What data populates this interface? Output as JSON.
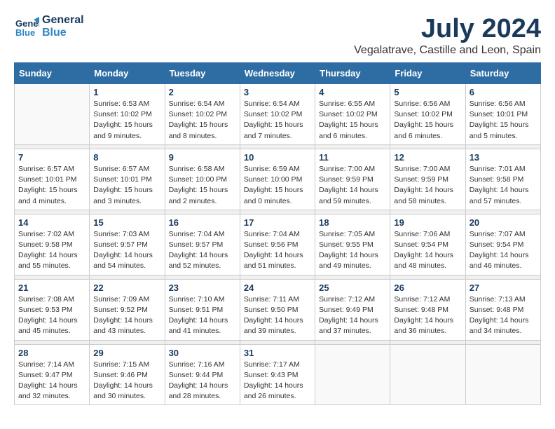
{
  "header": {
    "logo_line1": "General",
    "logo_line2": "Blue",
    "month_title": "July 2024",
    "location": "Vegalatrave, Castille and Leon, Spain"
  },
  "weekdays": [
    "Sunday",
    "Monday",
    "Tuesday",
    "Wednesday",
    "Thursday",
    "Friday",
    "Saturday"
  ],
  "weeks": [
    [
      {
        "day": "",
        "info": ""
      },
      {
        "day": "1",
        "info": "Sunrise: 6:53 AM\nSunset: 10:02 PM\nDaylight: 15 hours\nand 9 minutes."
      },
      {
        "day": "2",
        "info": "Sunrise: 6:54 AM\nSunset: 10:02 PM\nDaylight: 15 hours\nand 8 minutes."
      },
      {
        "day": "3",
        "info": "Sunrise: 6:54 AM\nSunset: 10:02 PM\nDaylight: 15 hours\nand 7 minutes."
      },
      {
        "day": "4",
        "info": "Sunrise: 6:55 AM\nSunset: 10:02 PM\nDaylight: 15 hours\nand 6 minutes."
      },
      {
        "day": "5",
        "info": "Sunrise: 6:56 AM\nSunset: 10:02 PM\nDaylight: 15 hours\nand 6 minutes."
      },
      {
        "day": "6",
        "info": "Sunrise: 6:56 AM\nSunset: 10:01 PM\nDaylight: 15 hours\nand 5 minutes."
      }
    ],
    [
      {
        "day": "7",
        "info": "Sunrise: 6:57 AM\nSunset: 10:01 PM\nDaylight: 15 hours\nand 4 minutes."
      },
      {
        "day": "8",
        "info": "Sunrise: 6:57 AM\nSunset: 10:01 PM\nDaylight: 15 hours\nand 3 minutes."
      },
      {
        "day": "9",
        "info": "Sunrise: 6:58 AM\nSunset: 10:00 PM\nDaylight: 15 hours\nand 2 minutes."
      },
      {
        "day": "10",
        "info": "Sunrise: 6:59 AM\nSunset: 10:00 PM\nDaylight: 15 hours\nand 0 minutes."
      },
      {
        "day": "11",
        "info": "Sunrise: 7:00 AM\nSunset: 9:59 PM\nDaylight: 14 hours\nand 59 minutes."
      },
      {
        "day": "12",
        "info": "Sunrise: 7:00 AM\nSunset: 9:59 PM\nDaylight: 14 hours\nand 58 minutes."
      },
      {
        "day": "13",
        "info": "Sunrise: 7:01 AM\nSunset: 9:58 PM\nDaylight: 14 hours\nand 57 minutes."
      }
    ],
    [
      {
        "day": "14",
        "info": "Sunrise: 7:02 AM\nSunset: 9:58 PM\nDaylight: 14 hours\nand 55 minutes."
      },
      {
        "day": "15",
        "info": "Sunrise: 7:03 AM\nSunset: 9:57 PM\nDaylight: 14 hours\nand 54 minutes."
      },
      {
        "day": "16",
        "info": "Sunrise: 7:04 AM\nSunset: 9:57 PM\nDaylight: 14 hours\nand 52 minutes."
      },
      {
        "day": "17",
        "info": "Sunrise: 7:04 AM\nSunset: 9:56 PM\nDaylight: 14 hours\nand 51 minutes."
      },
      {
        "day": "18",
        "info": "Sunrise: 7:05 AM\nSunset: 9:55 PM\nDaylight: 14 hours\nand 49 minutes."
      },
      {
        "day": "19",
        "info": "Sunrise: 7:06 AM\nSunset: 9:54 PM\nDaylight: 14 hours\nand 48 minutes."
      },
      {
        "day": "20",
        "info": "Sunrise: 7:07 AM\nSunset: 9:54 PM\nDaylight: 14 hours\nand 46 minutes."
      }
    ],
    [
      {
        "day": "21",
        "info": "Sunrise: 7:08 AM\nSunset: 9:53 PM\nDaylight: 14 hours\nand 45 minutes."
      },
      {
        "day": "22",
        "info": "Sunrise: 7:09 AM\nSunset: 9:52 PM\nDaylight: 14 hours\nand 43 minutes."
      },
      {
        "day": "23",
        "info": "Sunrise: 7:10 AM\nSunset: 9:51 PM\nDaylight: 14 hours\nand 41 minutes."
      },
      {
        "day": "24",
        "info": "Sunrise: 7:11 AM\nSunset: 9:50 PM\nDaylight: 14 hours\nand 39 minutes."
      },
      {
        "day": "25",
        "info": "Sunrise: 7:12 AM\nSunset: 9:49 PM\nDaylight: 14 hours\nand 37 minutes."
      },
      {
        "day": "26",
        "info": "Sunrise: 7:12 AM\nSunset: 9:48 PM\nDaylight: 14 hours\nand 36 minutes."
      },
      {
        "day": "27",
        "info": "Sunrise: 7:13 AM\nSunset: 9:48 PM\nDaylight: 14 hours\nand 34 minutes."
      }
    ],
    [
      {
        "day": "28",
        "info": "Sunrise: 7:14 AM\nSunset: 9:47 PM\nDaylight: 14 hours\nand 32 minutes."
      },
      {
        "day": "29",
        "info": "Sunrise: 7:15 AM\nSunset: 9:46 PM\nDaylight: 14 hours\nand 30 minutes."
      },
      {
        "day": "30",
        "info": "Sunrise: 7:16 AM\nSunset: 9:44 PM\nDaylight: 14 hours\nand 28 minutes."
      },
      {
        "day": "31",
        "info": "Sunrise: 7:17 AM\nSunset: 9:43 PM\nDaylight: 14 hours\nand 26 minutes."
      },
      {
        "day": "",
        "info": ""
      },
      {
        "day": "",
        "info": ""
      },
      {
        "day": "",
        "info": ""
      }
    ]
  ]
}
